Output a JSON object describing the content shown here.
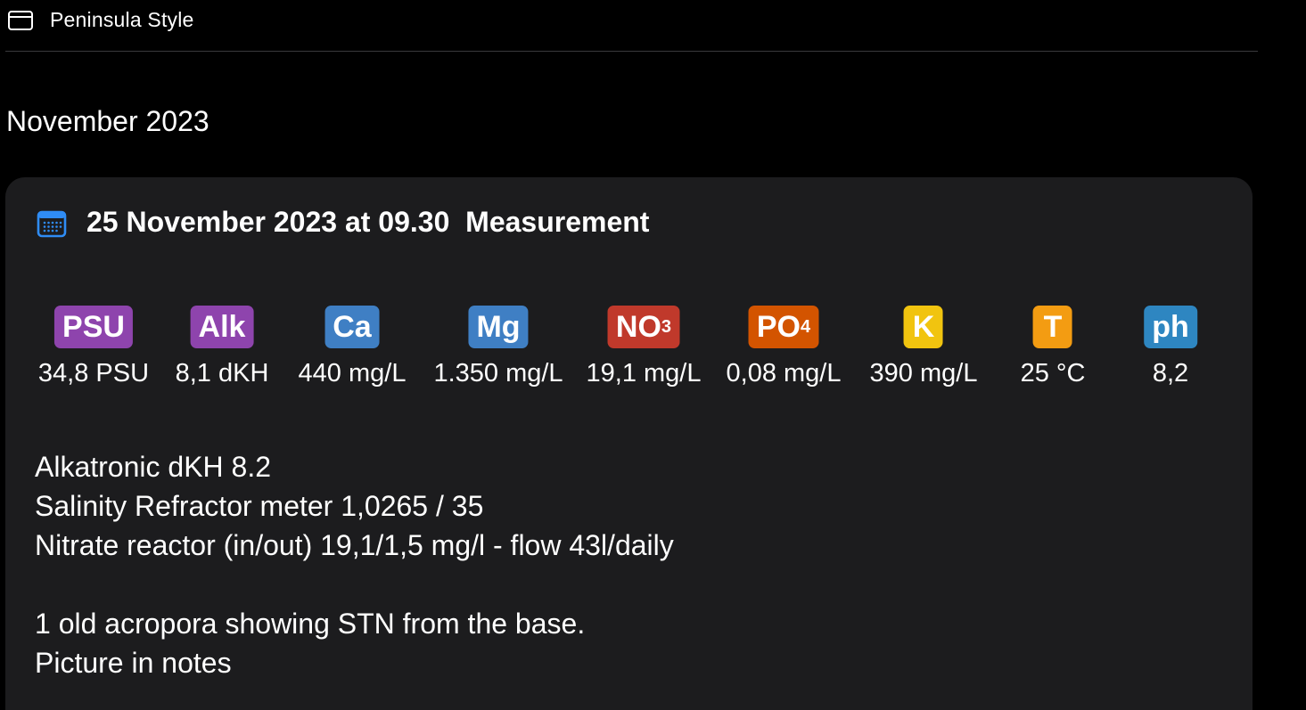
{
  "window": {
    "title": "Peninsula Style",
    "icon": "window-icon"
  },
  "section": {
    "month": "November 2023"
  },
  "entry": {
    "icon": "calendar-icon",
    "datetime": "25 November 2023 at 09.30",
    "type": "Measurement",
    "parameters": [
      {
        "label": "PSU",
        "value": "34,8 PSU",
        "color": "#8e44ad"
      },
      {
        "label": "Alk",
        "value": "8,1 dKH",
        "color": "#8e44ad"
      },
      {
        "label": "Ca",
        "value": "440 mg/L",
        "color": "#3f7fc4"
      },
      {
        "label": "Mg",
        "value": "1.350 mg/L",
        "color": "#3f7fc4"
      },
      {
        "label": "NO",
        "sub": "3",
        "value": "19,1 mg/L",
        "color": "#c0392b"
      },
      {
        "label": "PO",
        "sub": "4",
        "value": "0,08 mg/L",
        "color": "#d35400"
      },
      {
        "label": "K",
        "value": "390 mg/L",
        "color": "#f1c40f"
      },
      {
        "label": "T",
        "value": "25 °C",
        "color": "#f39c12"
      },
      {
        "label": "ph",
        "value": "8,2",
        "color": "#2e86c1"
      }
    ],
    "notes": [
      "Alkatronic dKH 8.2",
      "Salinity Refractor meter 1,0265 / 35",
      "Nitrate reactor (in/out) 19,1/1,5 mg/l - flow 43l/daily",
      "",
      "1 old acropora showing STN from the base.",
      "Picture in notes"
    ]
  }
}
